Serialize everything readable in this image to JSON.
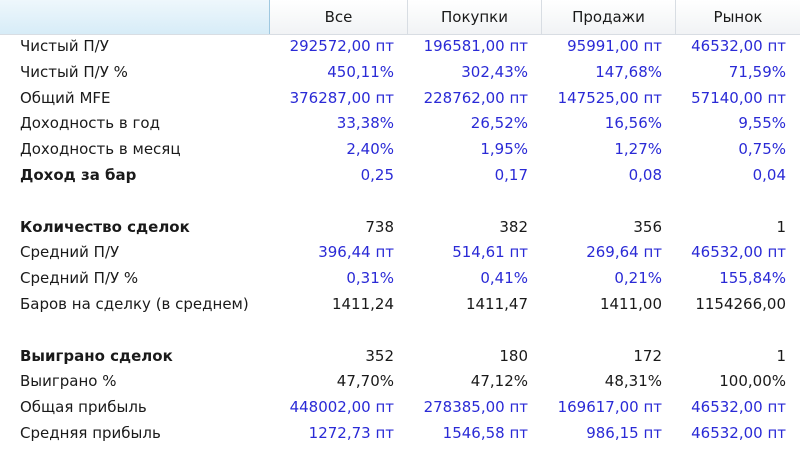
{
  "header": {
    "col_all": "Все",
    "col_buy": "Покупки",
    "col_sell": "Продажи",
    "col_market": "Рынок"
  },
  "rows": [
    {
      "label": "Чистый П/У",
      "all": "292572,00 пт",
      "buy": "196581,00 пт",
      "sell": "95991,00 пт",
      "market": "46532,00 пт"
    },
    {
      "label": "Чистый П/У %",
      "all": "450,11%",
      "buy": "302,43%",
      "sell": "147,68%",
      "market": "71,59%"
    },
    {
      "label": "Общий MFE",
      "all": "376287,00 пт",
      "buy": "228762,00 пт",
      "sell": "147525,00 пт",
      "market": "57140,00 пт"
    },
    {
      "label": "Доходность в год",
      "all": "33,38%",
      "buy": "26,52%",
      "sell": "16,56%",
      "market": "9,55%"
    },
    {
      "label": "Доходность в месяц",
      "all": "2,40%",
      "buy": "1,95%",
      "sell": "1,27%",
      "market": "0,75%"
    },
    {
      "label": "Доход за бар",
      "all": "0,25",
      "buy": "0,17",
      "sell": "0,08",
      "market": "0,04"
    },
    {
      "label": "Количество сделок",
      "all": "738",
      "buy": "382",
      "sell": "356",
      "market": "1"
    },
    {
      "label": "Средний П/У",
      "all": "396,44 пт",
      "buy": "514,61 пт",
      "sell": "269,64 пт",
      "market": "46532,00 пт"
    },
    {
      "label": "Средний П/У %",
      "all": "0,31%",
      "buy": "0,41%",
      "sell": "0,21%",
      "market": "155,84%"
    },
    {
      "label": "Баров на сделку (в среднем)",
      "all": "1411,24",
      "buy": "1411,47",
      "sell": "1411,00",
      "market": "1154266,00"
    },
    {
      "label": "Выиграно сделок",
      "all": "352",
      "buy": "180",
      "sell": "172",
      "market": "1"
    },
    {
      "label": "Выиграно %",
      "all": "47,70%",
      "buy": "47,12%",
      "sell": "48,31%",
      "market": "100,00%"
    },
    {
      "label": "Общая прибыль",
      "all": "448002,00 пт",
      "buy": "278385,00 пт",
      "sell": "169617,00 пт",
      "market": "46532,00 пт"
    },
    {
      "label": "Средняя прибыль",
      "all": "1272,73 пт",
      "buy": "1546,58 пт",
      "sell": "986,15 пт",
      "market": "46532,00 пт"
    }
  ],
  "colors": {
    "value_blue": "#2a2ad6",
    "value_black": "#1a1a1a",
    "corner_header": "#d7ecf7"
  }
}
